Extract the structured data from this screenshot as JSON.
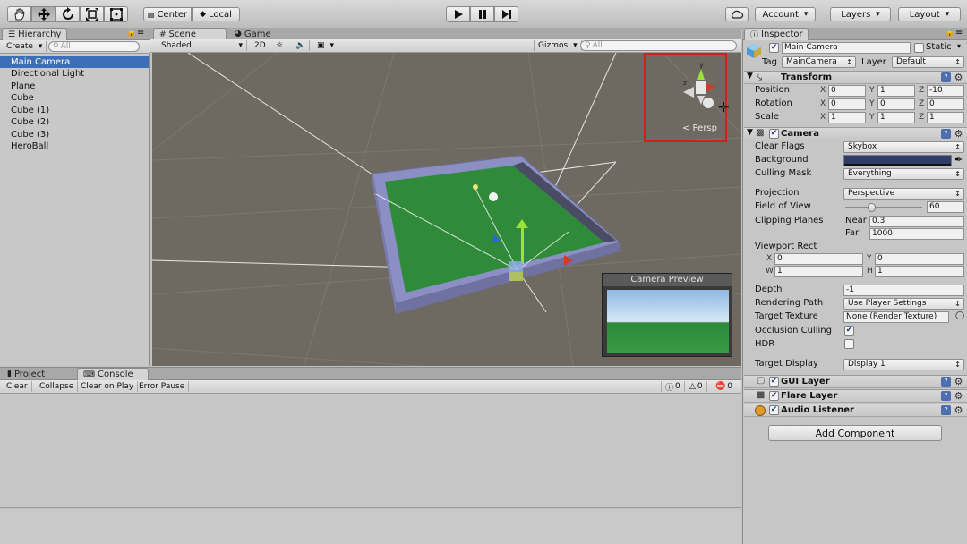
{
  "toolbar": {
    "tools": [
      "hand-tool",
      "move-tool",
      "rotate-tool",
      "scale-tool",
      "rect-tool"
    ],
    "pivot_label": "Center",
    "space_label": "Local",
    "account_label": "Account",
    "layers_label": "Layers",
    "layout_label": "Layout"
  },
  "hierarchy": {
    "tab_label": "Hierarchy",
    "create_label": "Create",
    "search_placeholder": "All",
    "items": [
      "Main Camera",
      "Directional Light",
      "Plane",
      "Cube",
      "Cube (1)",
      "Cube (2)",
      "Cube (3)",
      "HeroBall"
    ],
    "selected_index": 0
  },
  "scene": {
    "tabs": [
      "Scene",
      "Game"
    ],
    "shading_mode": "Shaded",
    "mode_2d": "2D",
    "gizmos_label": "Gizmos",
    "search_placeholder": "All",
    "persp_label": "< Persp",
    "camera_preview_title": "Camera Preview"
  },
  "console": {
    "tabs": [
      "Project",
      "Console"
    ],
    "buttons": [
      "Clear",
      "Collapse",
      "Clear on Play",
      "Error Pause"
    ],
    "counts": [
      "0",
      "0",
      "0"
    ]
  },
  "inspector": {
    "tab_label": "Inspector",
    "object_name": "Main Camera",
    "static_label": "Static",
    "tag_label": "Tag",
    "tag_value": "MainCamera",
    "layer_label": "Layer",
    "layer_value": "Default",
    "transform": {
      "title": "Transform",
      "rows": [
        {
          "label": "Position",
          "x": "0",
          "y": "1",
          "z": "-10"
        },
        {
          "label": "Rotation",
          "x": "0",
          "y": "0",
          "z": "0"
        },
        {
          "label": "Scale",
          "x": "1",
          "y": "1",
          "z": "1"
        }
      ]
    },
    "camera": {
      "title": "Camera",
      "clear_flags_label": "Clear Flags",
      "clear_flags_value": "Skybox",
      "background_label": "Background",
      "background_color": "#2f3c6a",
      "culling_mask_label": "Culling Mask",
      "culling_mask_value": "Everything",
      "projection_label": "Projection",
      "projection_value": "Perspective",
      "fov_label": "Field of View",
      "fov_value": "60",
      "fov_fraction": 0.333,
      "clipping_label": "Clipping Planes",
      "near_label": "Near",
      "near_value": "0.3",
      "far_label": "Far",
      "far_value": "1000",
      "viewport_label": "Viewport Rect",
      "vp_x": "0",
      "vp_y": "0",
      "vp_w": "1",
      "vp_h": "1",
      "depth_label": "Depth",
      "depth_value": "-1",
      "rendering_path_label": "Rendering Path",
      "rendering_path_value": "Use Player Settings",
      "target_texture_label": "Target Texture",
      "target_texture_value": "None (Render Texture)",
      "occlusion_label": "Occlusion Culling",
      "occlusion_checked": true,
      "hdr_label": "HDR",
      "hdr_checked": false,
      "target_display_label": "Target Display",
      "target_display_value": "Display 1"
    },
    "components": [
      "GUI Layer",
      "Flare Layer",
      "Audio Listener"
    ],
    "add_component_label": "Add Component"
  },
  "colors": {
    "selection": "#3d6fb8",
    "scene_bg": "#6e6a62",
    "ground": "#2f8a3a",
    "wall": "#8b8fc4",
    "highlight_box": "#d0201c"
  }
}
